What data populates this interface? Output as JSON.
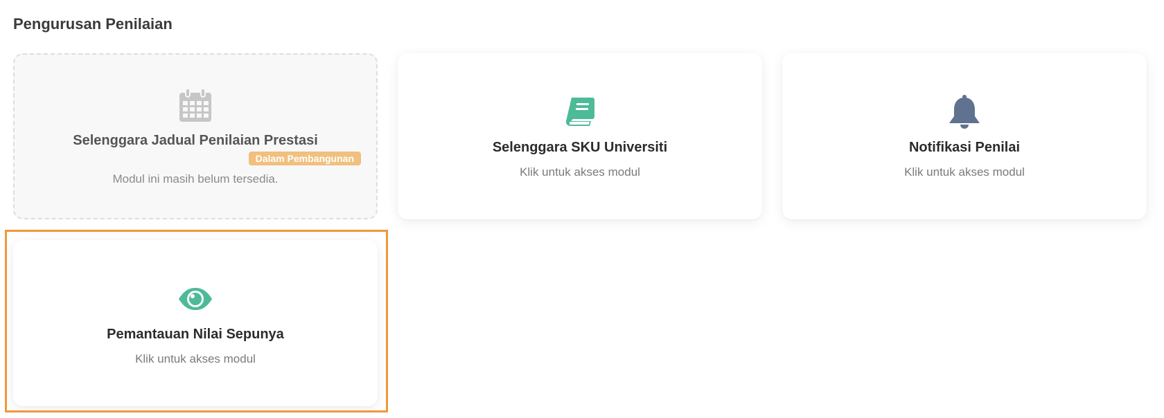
{
  "section": {
    "title": "Pengurusan Penilaian"
  },
  "cards": [
    {
      "icon": "calendar-icon",
      "title": "Selenggara Jadual Penilaian Prestasi",
      "badge": "Dalam Pembangunan",
      "subtitle": "Modul ini masih belum tersedia.",
      "disabled": true
    },
    {
      "icon": "book-icon",
      "title": "Selenggara SKU Universiti",
      "subtitle": "Klik untuk akses modul"
    },
    {
      "icon": "bell-icon",
      "title": "Notifikasi Penilai",
      "subtitle": "Klik untuk akses modul"
    },
    {
      "icon": "eye-icon",
      "title": "Pemantauan Nilai Sepunya",
      "subtitle": "Klik untuk akses modul",
      "focused": true
    }
  ],
  "colors": {
    "green_accent": "#4dba98",
    "bell": "#5f728f",
    "calendar": "#c6c6c6",
    "badge": "#f0c07e",
    "focus_ring": "#f0983a"
  }
}
